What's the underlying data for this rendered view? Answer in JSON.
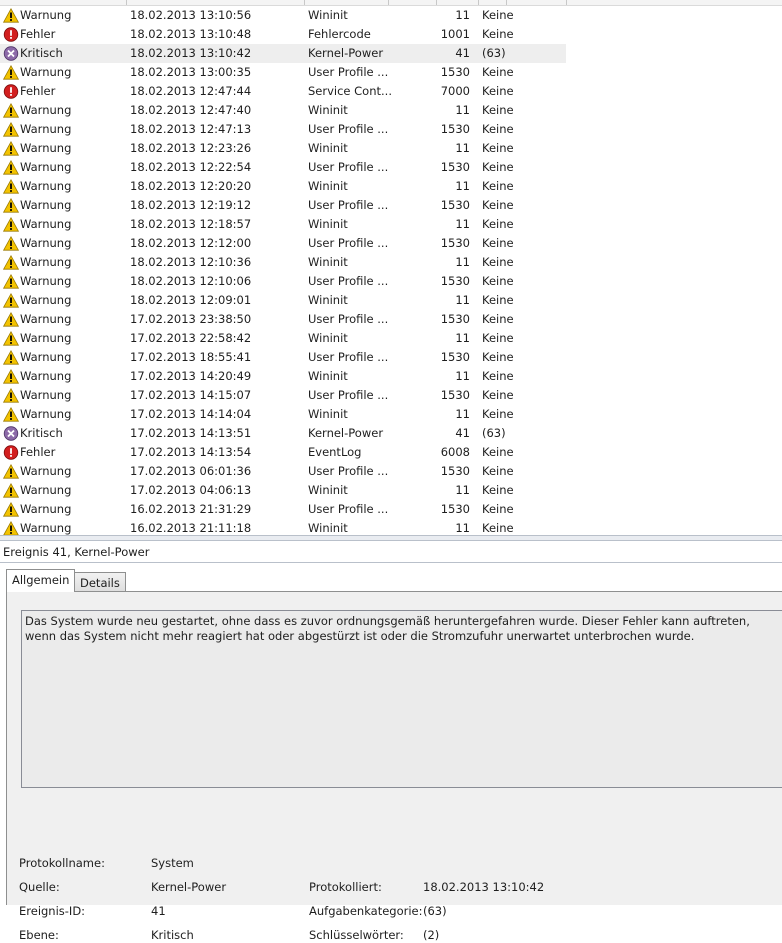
{
  "events": [
    {
      "level": "Warnung",
      "icon": "warning-icon",
      "date": "18.02.2013 13:10:56",
      "source": "Wininit",
      "id": "11",
      "category": "Keine"
    },
    {
      "level": "Fehler",
      "icon": "error-icon",
      "date": "18.02.2013 13:10:48",
      "source": "Fehlercode",
      "id": "1001",
      "category": "Keine"
    },
    {
      "level": "Kritisch",
      "icon": "critical-icon",
      "date": "18.02.2013 13:10:42",
      "source": "Kernel-Power",
      "id": "41",
      "category": "(63)",
      "selected": true
    },
    {
      "level": "Warnung",
      "icon": "warning-icon",
      "date": "18.02.2013 13:00:35",
      "source": "User Profile ...",
      "id": "1530",
      "category": "Keine"
    },
    {
      "level": "Fehler",
      "icon": "error-icon",
      "date": "18.02.2013 12:47:44",
      "source": "Service Cont...",
      "id": "7000",
      "category": "Keine"
    },
    {
      "level": "Warnung",
      "icon": "warning-icon",
      "date": "18.02.2013 12:47:40",
      "source": "Wininit",
      "id": "11",
      "category": "Keine"
    },
    {
      "level": "Warnung",
      "icon": "warning-icon",
      "date": "18.02.2013 12:47:13",
      "source": "User Profile ...",
      "id": "1530",
      "category": "Keine"
    },
    {
      "level": "Warnung",
      "icon": "warning-icon",
      "date": "18.02.2013 12:23:26",
      "source": "Wininit",
      "id": "11",
      "category": "Keine"
    },
    {
      "level": "Warnung",
      "icon": "warning-icon",
      "date": "18.02.2013 12:22:54",
      "source": "User Profile ...",
      "id": "1530",
      "category": "Keine"
    },
    {
      "level": "Warnung",
      "icon": "warning-icon",
      "date": "18.02.2013 12:20:20",
      "source": "Wininit",
      "id": "11",
      "category": "Keine"
    },
    {
      "level": "Warnung",
      "icon": "warning-icon",
      "date": "18.02.2013 12:19:12",
      "source": "User Profile ...",
      "id": "1530",
      "category": "Keine"
    },
    {
      "level": "Warnung",
      "icon": "warning-icon",
      "date": "18.02.2013 12:18:57",
      "source": "Wininit",
      "id": "11",
      "category": "Keine"
    },
    {
      "level": "Warnung",
      "icon": "warning-icon",
      "date": "18.02.2013 12:12:00",
      "source": "User Profile ...",
      "id": "1530",
      "category": "Keine"
    },
    {
      "level": "Warnung",
      "icon": "warning-icon",
      "date": "18.02.2013 12:10:36",
      "source": "Wininit",
      "id": "11",
      "category": "Keine"
    },
    {
      "level": "Warnung",
      "icon": "warning-icon",
      "date": "18.02.2013 12:10:06",
      "source": "User Profile ...",
      "id": "1530",
      "category": "Keine"
    },
    {
      "level": "Warnung",
      "icon": "warning-icon",
      "date": "18.02.2013 12:09:01",
      "source": "Wininit",
      "id": "11",
      "category": "Keine"
    },
    {
      "level": "Warnung",
      "icon": "warning-icon",
      "date": "17.02.2013 23:38:50",
      "source": "User Profile ...",
      "id": "1530",
      "category": "Keine"
    },
    {
      "level": "Warnung",
      "icon": "warning-icon",
      "date": "17.02.2013 22:58:42",
      "source": "Wininit",
      "id": "11",
      "category": "Keine"
    },
    {
      "level": "Warnung",
      "icon": "warning-icon",
      "date": "17.02.2013 18:55:41",
      "source": "User Profile ...",
      "id": "1530",
      "category": "Keine"
    },
    {
      "level": "Warnung",
      "icon": "warning-icon",
      "date": "17.02.2013 14:20:49",
      "source": "Wininit",
      "id": "11",
      "category": "Keine"
    },
    {
      "level": "Warnung",
      "icon": "warning-icon",
      "date": "17.02.2013 14:15:07",
      "source": "User Profile ...",
      "id": "1530",
      "category": "Keine"
    },
    {
      "level": "Warnung",
      "icon": "warning-icon",
      "date": "17.02.2013 14:14:04",
      "source": "Wininit",
      "id": "11",
      "category": "Keine"
    },
    {
      "level": "Kritisch",
      "icon": "critical-icon",
      "date": "17.02.2013 14:13:51",
      "source": "Kernel-Power",
      "id": "41",
      "category": "(63)"
    },
    {
      "level": "Fehler",
      "icon": "error-icon",
      "date": "17.02.2013 14:13:54",
      "source": "EventLog",
      "id": "6008",
      "category": "Keine"
    },
    {
      "level": "Warnung",
      "icon": "warning-icon",
      "date": "17.02.2013 06:01:36",
      "source": "User Profile ...",
      "id": "1530",
      "category": "Keine"
    },
    {
      "level": "Warnung",
      "icon": "warning-icon",
      "date": "17.02.2013 04:06:13",
      "source": "Wininit",
      "id": "11",
      "category": "Keine"
    },
    {
      "level": "Warnung",
      "icon": "warning-icon",
      "date": "16.02.2013 21:31:29",
      "source": "User Profile ...",
      "id": "1530",
      "category": "Keine"
    },
    {
      "level": "Warnung",
      "icon": "warning-icon",
      "date": "16.02.2013 21:11:18",
      "source": "Wininit",
      "id": "11",
      "category": "Keine"
    }
  ],
  "colors": {
    "warning": "#f3c300",
    "error": "#d21f1f",
    "critical": "#8c6aa8",
    "selected_row": "#eeeeee"
  },
  "detail": {
    "title": "Ereignis 41, Kernel-Power",
    "tabs": {
      "general": "Allgemein",
      "details": "Details"
    },
    "description": "Das System wurde neu gestartet, ohne dass es zuvor ordnungsgemäß heruntergefahren wurde. Dieser Fehler kann auftreten, wenn das System nicht mehr reagiert hat oder abgestürzt ist oder die Stromzufuhr unerwartet unterbrochen wurde.",
    "props": {
      "log_name_label": "Protokollname:",
      "log_name": "System",
      "source_label": "Quelle:",
      "source": "Kernel-Power",
      "logged_label": "Protokolliert:",
      "logged": "18.02.2013 13:10:42",
      "event_id_label": "Ereignis-ID:",
      "event_id": "41",
      "task_category_label": "Aufgabenkategorie:",
      "task_category": "(63)",
      "level_label": "Ebene:",
      "level": "Kritisch",
      "keywords_label": "Schlüsselwörter:",
      "keywords": "(2)"
    }
  }
}
